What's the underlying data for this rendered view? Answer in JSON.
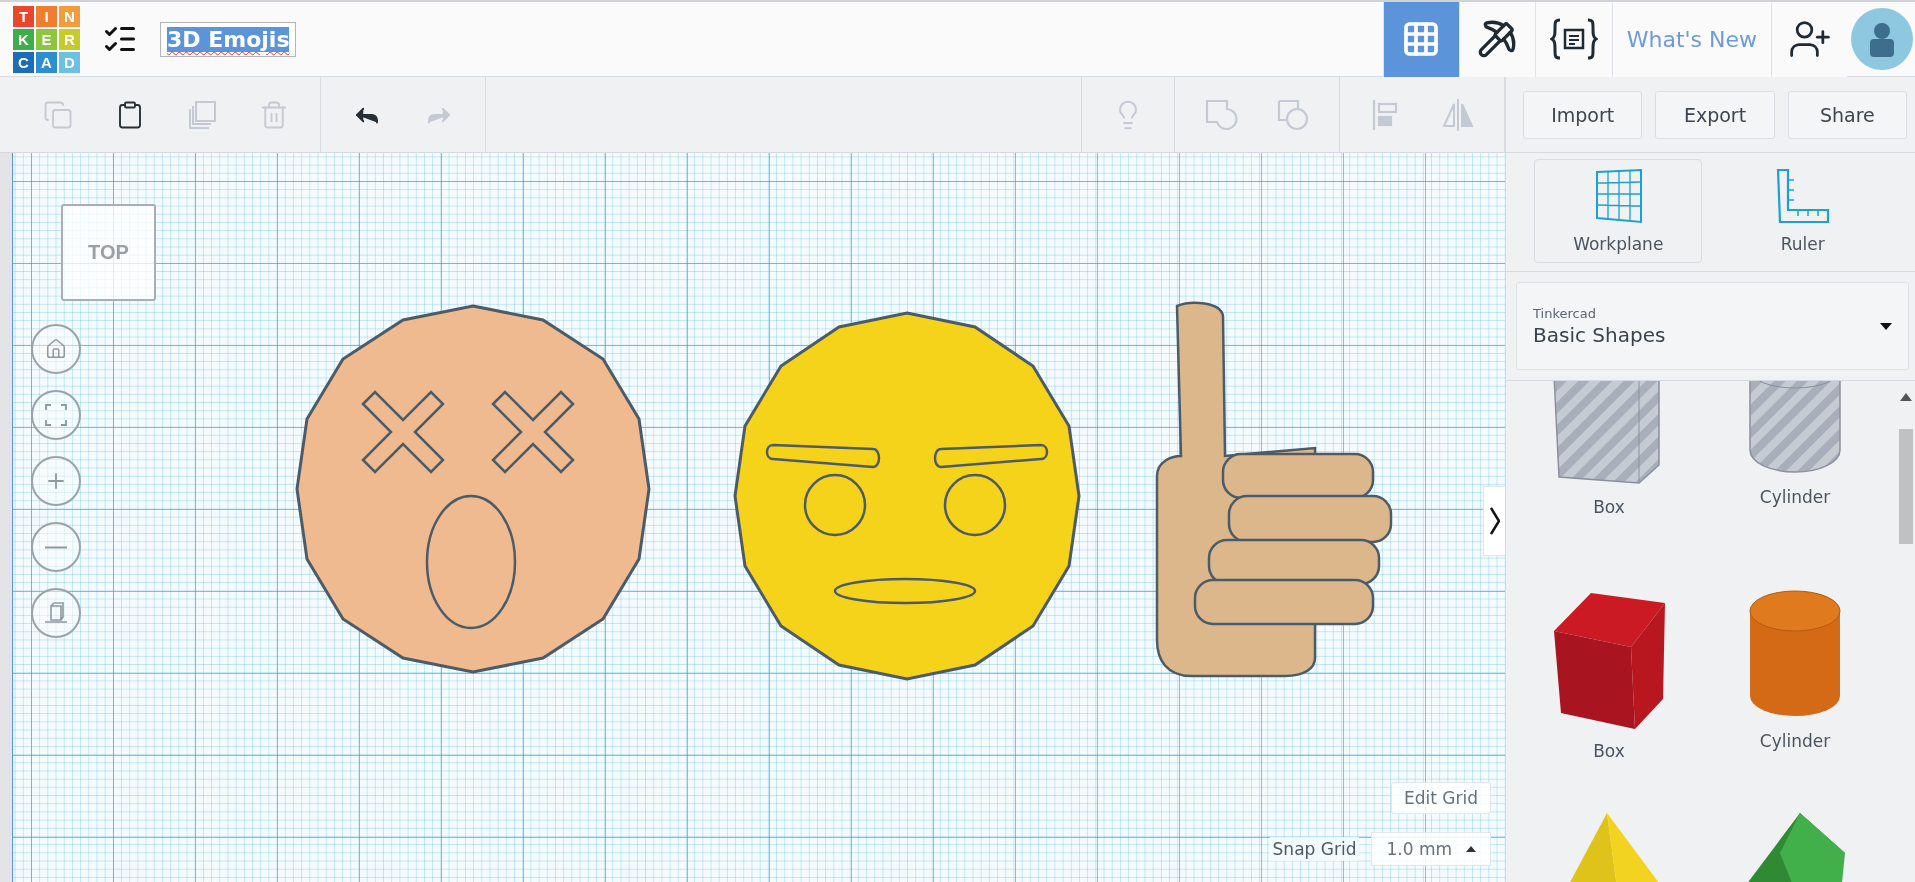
{
  "app": {
    "logo": [
      {
        "letter": "T",
        "color": "#e8472c"
      },
      {
        "letter": "I",
        "color": "#f07d30"
      },
      {
        "letter": "N",
        "color": "#f49b3b"
      },
      {
        "letter": "K",
        "color": "#3eae4a"
      },
      {
        "letter": "E",
        "color": "#8cc63f"
      },
      {
        "letter": "R",
        "color": "#c6cb2c"
      },
      {
        "letter": "C",
        "color": "#1b6db6"
      },
      {
        "letter": "A",
        "color": "#2d8fd2"
      },
      {
        "letter": "D",
        "color": "#6cc0e6"
      }
    ],
    "design_title": "3D Emojis"
  },
  "header_nav": [
    {
      "kind": "grid",
      "selected": true
    },
    {
      "kind": "pickaxe",
      "selected": false
    },
    {
      "kind": "code",
      "selected": false
    },
    {
      "kind": "link",
      "label": "What's New",
      "selected": false
    }
  ],
  "edit_tools": [
    {
      "kind": "copy",
      "disabled": true
    },
    {
      "kind": "paste",
      "disabled": false
    },
    {
      "kind": "duplicate",
      "disabled": true
    },
    {
      "kind": "delete",
      "disabled": true
    },
    {
      "kind": "undo",
      "disabled": false
    },
    {
      "kind": "redo",
      "disabled": true
    }
  ],
  "view_tools": [
    {
      "kind": "bulb",
      "disabled": true
    },
    {
      "kind": "group",
      "disabled": true
    },
    {
      "kind": "ungroup",
      "disabled": true
    },
    {
      "kind": "align",
      "disabled": true
    },
    {
      "kind": "mirror",
      "disabled": true
    }
  ],
  "actions": [
    "Import",
    "Export",
    "Share"
  ],
  "view_cube": {
    "label": "TOP"
  },
  "nav_controls": [
    {
      "kind": "home"
    },
    {
      "kind": "fit"
    },
    {
      "kind": "zoom-in"
    },
    {
      "kind": "zoom-out"
    },
    {
      "kind": "perspective"
    }
  ],
  "canvas_objects": [
    {
      "kind": "dizzy-face",
      "color": "#f0ba90"
    },
    {
      "kind": "angry-face",
      "color": "#f5d31b"
    },
    {
      "kind": "thumbs-up",
      "color": "#dcb78b"
    }
  ],
  "grid_controls": {
    "edit_button": "Edit Grid",
    "snap_label": "Snap Grid",
    "snap_value": "1.0 mm"
  },
  "panel": {
    "tools": [
      {
        "kind": "workplane",
        "label": "Workplane",
        "selected": true
      },
      {
        "kind": "ruler",
        "label": "Ruler",
        "selected": false
      }
    ],
    "library": {
      "source": "Tinkercad",
      "value": "Basic Shapes"
    },
    "shapes": [
      {
        "kind": "box-hole",
        "label": "Box"
      },
      {
        "kind": "cylinder-hole",
        "label": "Cylinder"
      },
      {
        "kind": "box",
        "label": "Box"
      },
      {
        "kind": "cylinder",
        "label": "Cylinder"
      },
      {
        "kind": "pyramid"
      },
      {
        "kind": "roof"
      }
    ]
  }
}
